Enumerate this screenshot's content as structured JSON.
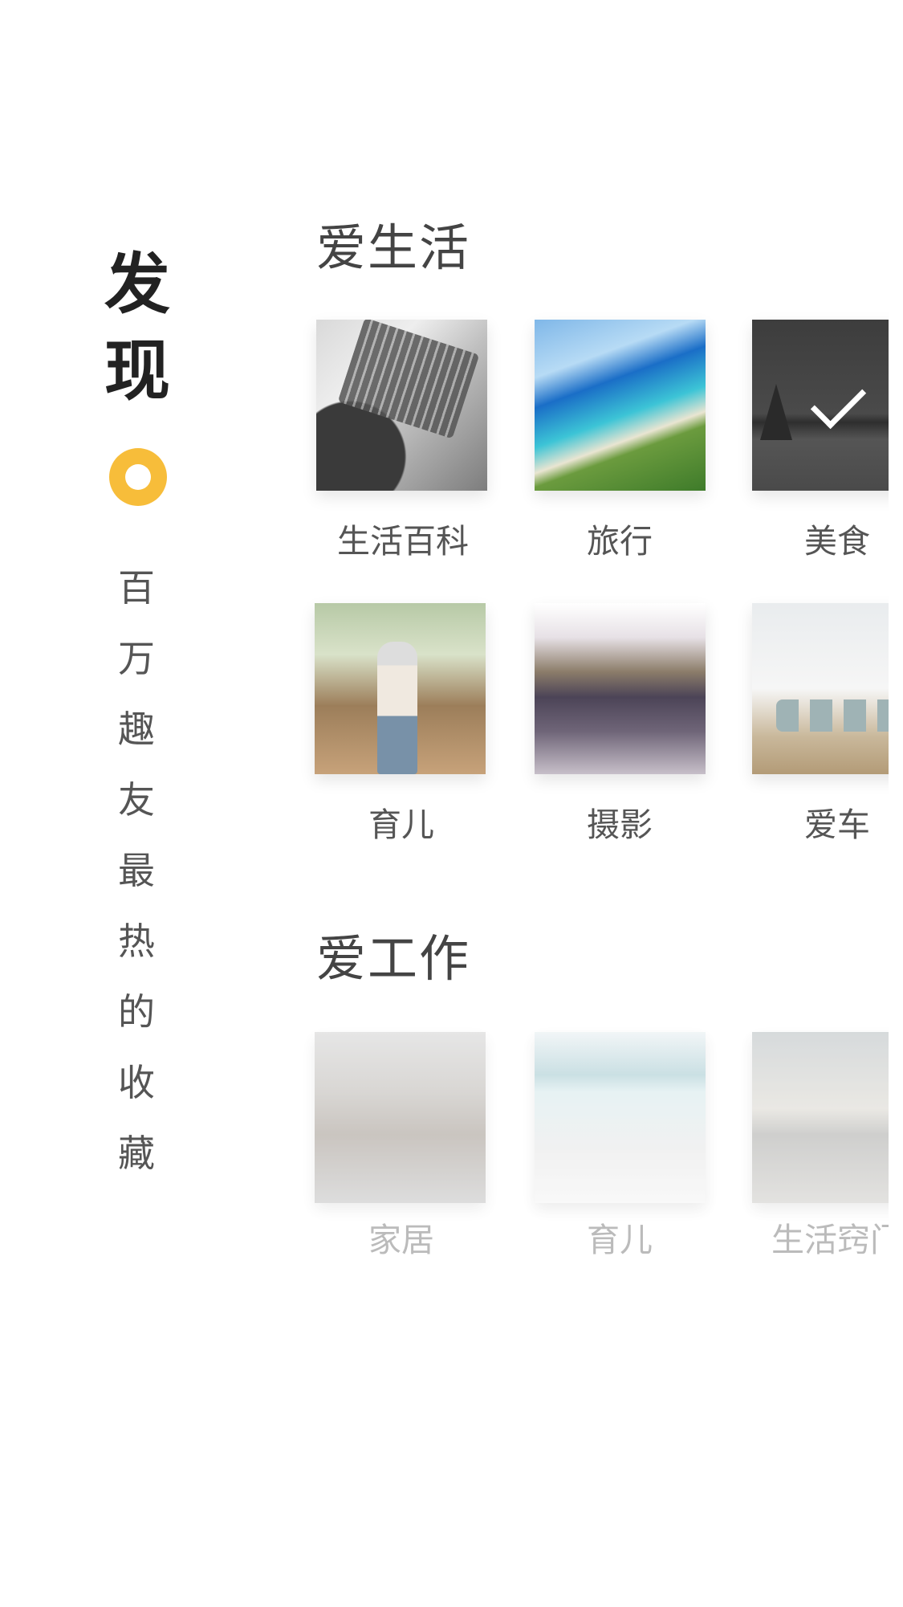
{
  "side": {
    "title": [
      "发",
      "现"
    ],
    "subtitle": [
      "百",
      "万",
      "趣",
      "友",
      "最",
      "热",
      "的",
      "收",
      "藏"
    ]
  },
  "sections": [
    {
      "title": "爱生活",
      "items": [
        {
          "label": "生活百科",
          "image": "laptop-photo",
          "selected": false
        },
        {
          "label": "旅行",
          "image": "beach-photo",
          "selected": false
        },
        {
          "label": "美食",
          "image": "foggy-lake-photo",
          "selected": true
        },
        {
          "label": "育儿",
          "image": "child-photo",
          "selected": false
        },
        {
          "label": "摄影",
          "image": "river-photo",
          "selected": false
        },
        {
          "label": "爱车",
          "image": "office-photo",
          "selected": false
        }
      ]
    },
    {
      "title": "爱工作",
      "items": [
        {
          "label": "家居",
          "image": "canyon-photo",
          "selected": false
        },
        {
          "label": "育儿",
          "image": "seascape-photo",
          "selected": false
        },
        {
          "label": "生活窍门",
          "image": "lake-photo",
          "selected": false
        }
      ]
    }
  ],
  "icons": {
    "selected": "checkmark-icon",
    "indicator": "ring-icon"
  },
  "colors": {
    "accent": "#f7bd3a"
  }
}
